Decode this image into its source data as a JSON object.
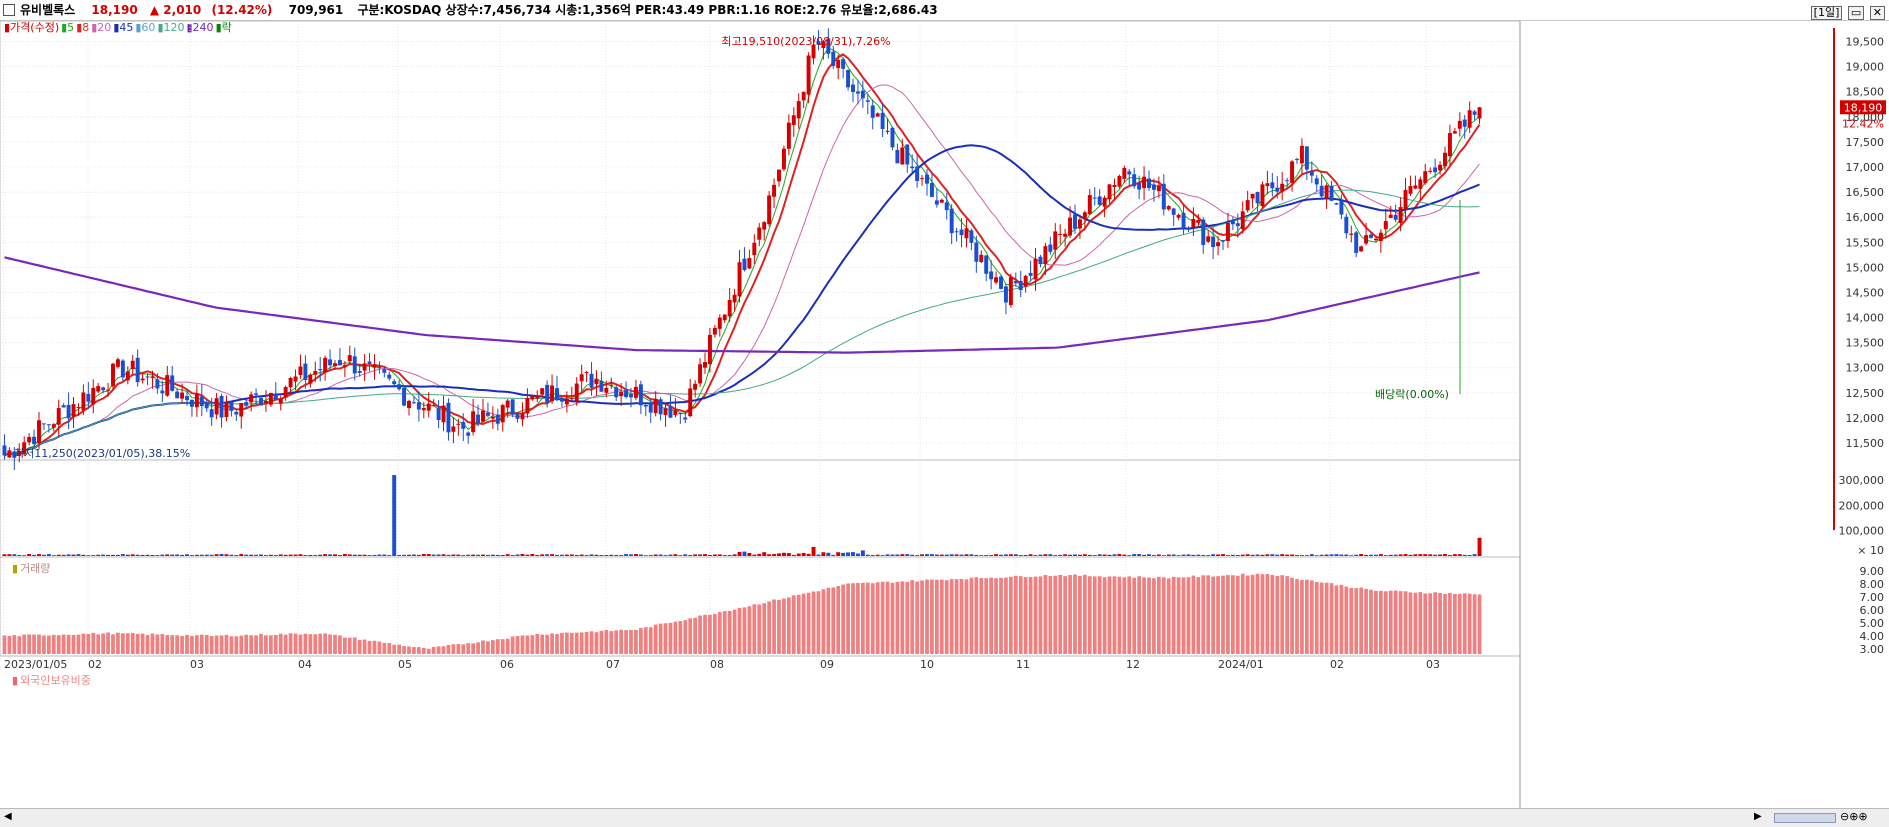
{
  "header": {
    "name": "유비벨록스",
    "price": "18,190",
    "change": "▲ 2,010",
    "change_pct": "(12.42%)",
    "volume": "709,961",
    "info": "구분:KOSDAQ 상장수:7,456,734 시총:1,356억 PER:43.49 PBR:1.16 ROE:2.76 유보율:2,686.43",
    "period_btn": "[1일]"
  },
  "legend_price": [
    {
      "text": "가격(수정)",
      "color": "#d40000"
    },
    {
      "text": "5",
      "color": "#22aa22"
    },
    {
      "text": "8",
      "color": "#dd2222"
    },
    {
      "text": "20",
      "color": "#cc66aa"
    },
    {
      "text": "45",
      "color": "#1a2fb8"
    },
    {
      "text": "60",
      "color": "#5aa0d0"
    },
    {
      "text": "120",
      "color": "#44aa88"
    },
    {
      "text": "240",
      "color": "#7a28b8"
    },
    {
      "text": "락",
      "color": "#008800"
    }
  ],
  "legend_volume": "거래량",
  "legend_foreign": "외국인보유비중",
  "chart_data": {
    "type": "candlestick",
    "x_labels": [
      "2023/01/05",
      "02",
      "03",
      "04",
      "05",
      "06",
      "07",
      "08",
      "09",
      "10",
      "11",
      "12",
      "2024/01",
      "02",
      "03"
    ],
    "y_ticks": [
      11500,
      12000,
      12500,
      13000,
      13500,
      14000,
      14500,
      15000,
      15500,
      16000,
      16500,
      17000,
      17500,
      18000,
      18500,
      19000,
      19500
    ],
    "ylim": [
      11200,
      19850
    ],
    "volume_ticks": [
      "300,000",
      "200,000",
      "100,000"
    ],
    "volume_unit": "× 10",
    "foreign_ticks": [
      "9.00",
      "8.00",
      "7.00",
      "6.00",
      "5.00",
      "4.00",
      "3.00"
    ],
    "last_price": "18,190",
    "last_pct": "12.42%",
    "annotations": {
      "high": "최고19,510(2023/08/31),7.26%",
      "low": "최저11,250(2023/01/05),38.15%",
      "dividend": "배당락(0.00%)"
    },
    "key_points": [
      {
        "date": "2023/01/05",
        "close": 11250
      },
      {
        "date": "2023/02 mid",
        "close": 13000
      },
      {
        "date": "2023/03 end",
        "close": 12100
      },
      {
        "date": "2023/04 mid",
        "close": 13200
      },
      {
        "date": "2023/05 start",
        "close": 11800
      },
      {
        "date": "2023/06 mid",
        "close": 12800
      },
      {
        "date": "2023/07 end",
        "close": 12100
      },
      {
        "date": "2023/08 mid",
        "close": 16500
      },
      {
        "date": "2023/08/31",
        "close": 19510
      },
      {
        "date": "2023/09 end",
        "close": 17100
      },
      {
        "date": "2023/10 end",
        "close": 14500
      },
      {
        "date": "2023/11 end",
        "close": 17000
      },
      {
        "date": "2023/12 mid",
        "close": 15500
      },
      {
        "date": "2024/01 end",
        "close": 17200
      },
      {
        "date": "2024/02 start",
        "close": 15300
      },
      {
        "date": "2024/03 end",
        "close": 18190
      }
    ],
    "volume_spikes": [
      {
        "date": "2023/04 end",
        "value": 320000
      },
      {
        "date": "2024/03 end",
        "value": 72000
      },
      {
        "date": "2023/08/31",
        "value": 36000
      }
    ]
  }
}
